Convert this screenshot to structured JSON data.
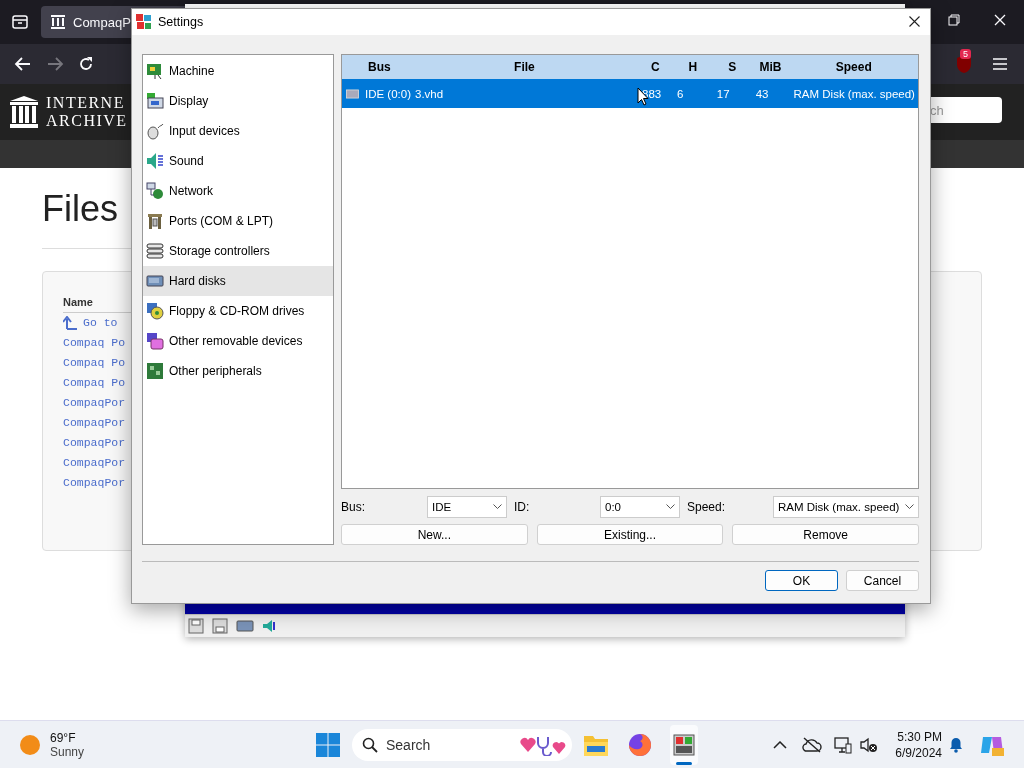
{
  "browser": {
    "tab_title": "CompaqP",
    "forward": {
      "disabled": true
    },
    "extension_badge": "5",
    "logo": [
      "INTERNE",
      "ARCHIVE"
    ],
    "site_search": {
      "placeholder": "ch"
    },
    "heading": "Files",
    "files_table": {
      "column": "Name",
      "parent_link": "Go to",
      "items": [
        "Compaq Po",
        "Compaq Po",
        "Compaq Po",
        "CompaqPor",
        "CompaqPor",
        "CompaqPor",
        "CompaqPor",
        "CompaqPor"
      ]
    }
  },
  "dialog": {
    "title": "Settings",
    "categories": [
      {
        "label": "Machine",
        "selected": false
      },
      {
        "label": "Display",
        "selected": false
      },
      {
        "label": "Input devices",
        "selected": false
      },
      {
        "label": "Sound",
        "selected": false
      },
      {
        "label": "Network",
        "selected": false
      },
      {
        "label": "Ports (COM & LPT)",
        "selected": false
      },
      {
        "label": "Storage controllers",
        "selected": false
      },
      {
        "label": "Hard disks",
        "selected": true
      },
      {
        "label": "Floppy & CD-ROM drives",
        "selected": false
      },
      {
        "label": "Other removable devices",
        "selected": false
      },
      {
        "label": "Other peripherals",
        "selected": false
      }
    ],
    "disks_table": {
      "columns": [
        "Bus",
        "File",
        "C",
        "H",
        "S",
        "MiB",
        "Speed"
      ],
      "rows": [
        {
          "cells": [
            "IDE (0:0)",
            "3.vhd",
            "883",
            "6",
            "17",
            "43",
            "RAM Disk (max. speed)"
          ],
          "selected": true
        }
      ]
    },
    "fields": [
      {
        "label": "Bus:",
        "value": "IDE"
      },
      {
        "label": "ID:",
        "value": "0:0"
      },
      {
        "label": "Speed:",
        "value": "RAM Disk (max. speed)"
      }
    ],
    "buttons": [
      "New...",
      "Existing...",
      "Remove"
    ],
    "footer_buttons": [
      {
        "label": "OK",
        "default": true
      },
      {
        "label": "Cancel",
        "default": false
      }
    ]
  },
  "taskbar": {
    "weather": {
      "temperature": "69°F",
      "condition": "Sunny"
    },
    "search": {
      "placeholder": "Search"
    },
    "clock": {
      "time": "5:30 PM",
      "date": "6/9/2024"
    }
  }
}
